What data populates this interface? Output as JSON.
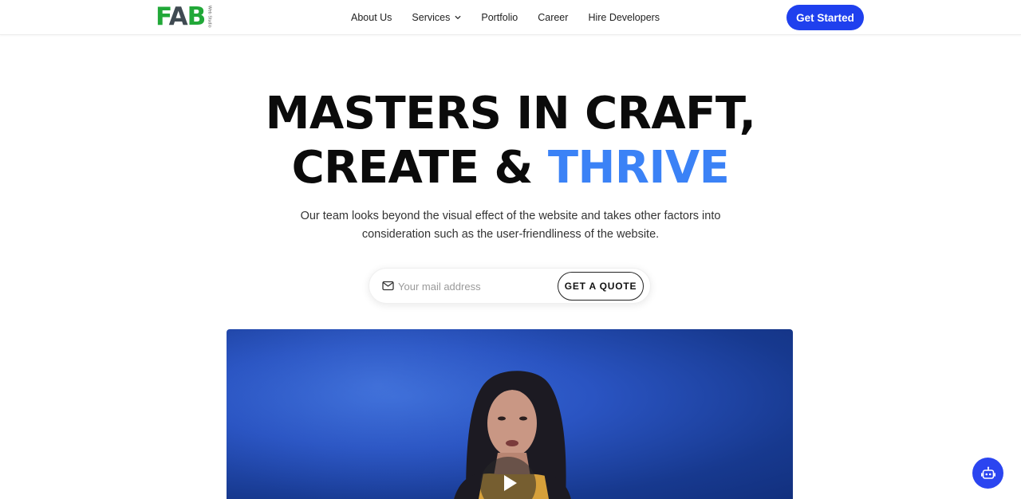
{
  "brand": {
    "logo_text_f": "F",
    "logo_text_a": "A",
    "logo_text_b": "B",
    "logo_tagline": "Web Studio",
    "colors": {
      "green": "#21a838",
      "dark": "#3f4a52"
    }
  },
  "nav": {
    "items": [
      {
        "label": "About Us"
      },
      {
        "label": "Services"
      },
      {
        "label": "Portfolio"
      },
      {
        "label": "Career"
      },
      {
        "label": "Hire Developers"
      }
    ],
    "cta_label": "Get Started",
    "cta_color": "#1f40ee"
  },
  "hero": {
    "line1": "MASTERS IN CRAFT,",
    "line2_prefix": "CREATE & ",
    "line2_accent": "THRIVE",
    "accent_color": "#3b82f6",
    "subtitle": "Our team looks beyond the visual effect of the website and takes other factors into consideration such as the user-friendliness of the website."
  },
  "quote_form": {
    "placeholder": "Your mail address",
    "value": "",
    "button_label": "GET A QUOTE",
    "icon": "mail-icon"
  },
  "video": {
    "background": "#2a54c2",
    "play_icon": "play-icon"
  },
  "chatbot": {
    "icon": "robot-icon",
    "color": "#2b45f0"
  }
}
